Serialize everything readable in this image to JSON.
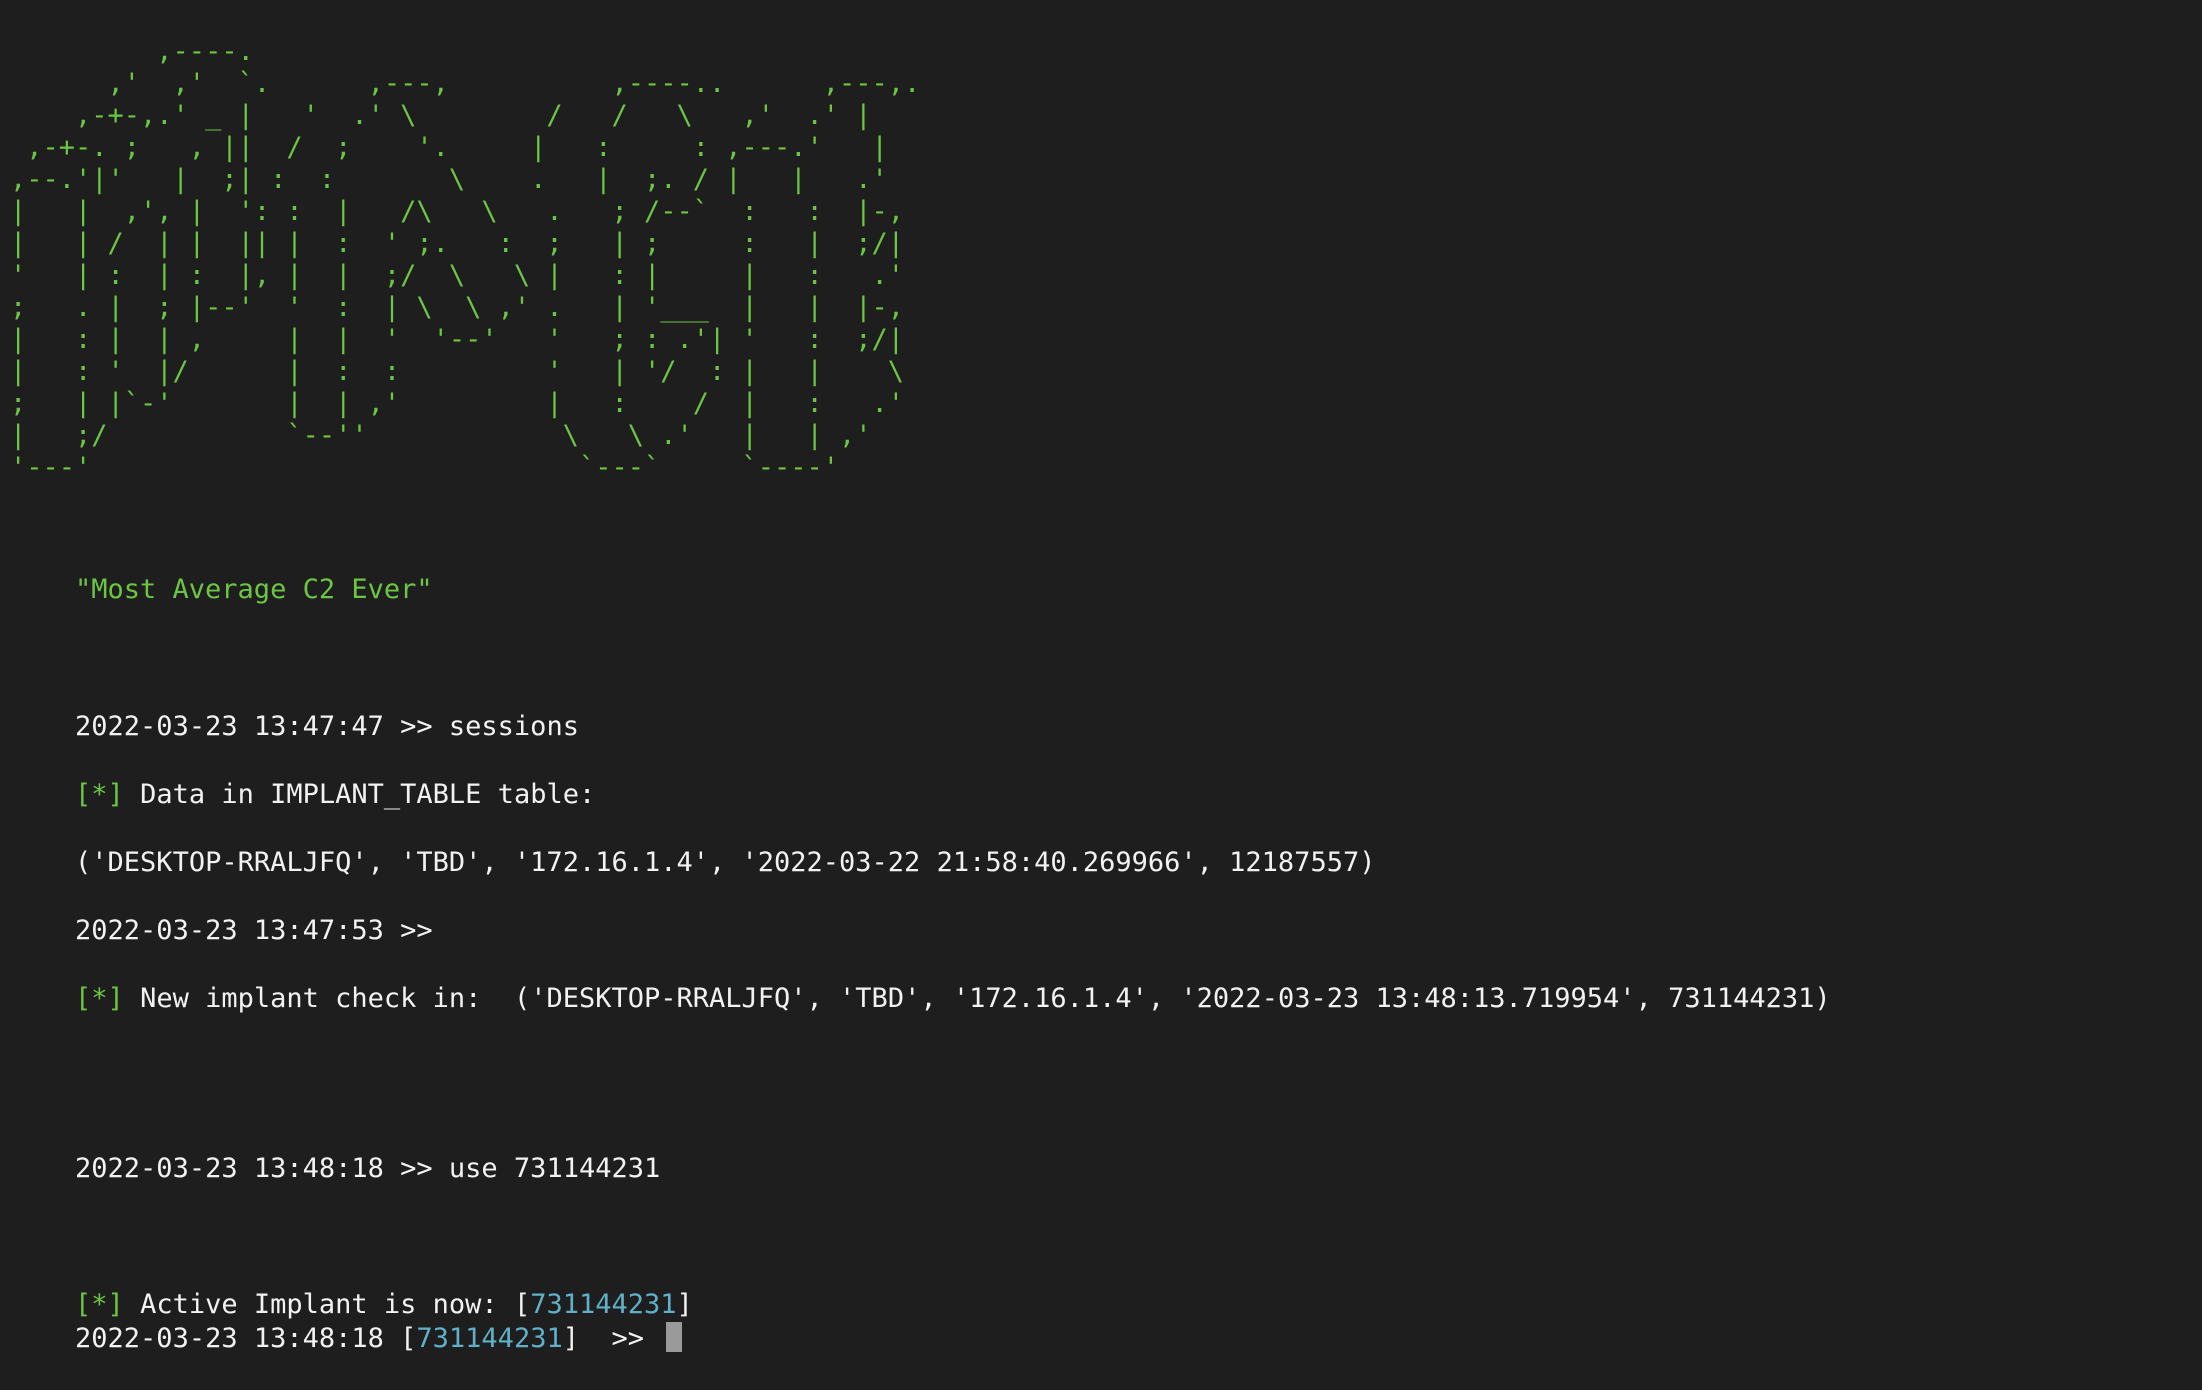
{
  "banner_art": "         ,----.\n      ,'  ,'  `.      ,---,          ,----..      ,---,.\n    ,-+-,.' _ |   '  .' \\        /   /   \\   ,'  .' |\n ,-+-. ;   , ||  /  ;    '.     |   :     : ,---.'   |\n,--.'|'   |  ;| :  :       \\    .   |  ;. / |   |   .'\n|   |  ,', |  ': :  |   /\\   \\   .   ; /--`  :   :  |-,\n|   | /  | |  || |  :  ' ;.   :  ;   | ;     :   |  ;/|\n'   | :  | :  |, |  |  ;/  \\   \\ |   : |     |   :   .'\n;   . |  ; |--'  '  :  | \\  \\ ,' .   | '___  |   |  |-,\n|   : |  | ,     |  |  '  '--'   '   ; : .'| '   :  ;/|\n|   : '  |/      |  :  :         '   | '/  : |   |    \\\n;   | |`-'       |  | ,'         |   :    /  |   :   .'\n|   ;/           `--''            \\   \\ .'   |   | ,'\n'---'                              `---`     `----'",
  "tagline": "\"Most Average C2 Ever\"",
  "lines": [
    {
      "prompt": "2022-03-23 13:47:47 >> ",
      "command": "sessions"
    },
    {
      "marker": "[*]",
      "text": " Data in IMPLANT_TABLE table:"
    },
    {
      "text": "('DESKTOP-RRALJFQ', 'TBD', '172.16.1.4', '2022-03-22 21:58:40.269966', 12187557)"
    },
    {
      "prompt": "2022-03-23 13:47:53 >>"
    },
    {
      "marker": "[*]",
      "text": " New implant check in:  ('DESKTOP-RRALJFQ', 'TBD', '172.16.1.4', '2022-03-23 13:48:13.719954', 731144231)"
    },
    {
      "prompt": "2022-03-23 13:48:18 >> ",
      "command": "use 731144231"
    },
    {
      "marker": "[*]",
      "text": " Active Implant is now: [",
      "implant_id": "731144231",
      "suffix": "]"
    },
    {
      "prompt_time": "2022-03-23 13:48:18 [",
      "implant_id": "731144231",
      "prompt_end": "]  >> "
    }
  ],
  "colors": {
    "background": "#1e1e1e",
    "text": "#f2f2f2",
    "green": "#6cc644",
    "cyan": "#5fb0c8",
    "cursor": "#9a9a9a"
  }
}
